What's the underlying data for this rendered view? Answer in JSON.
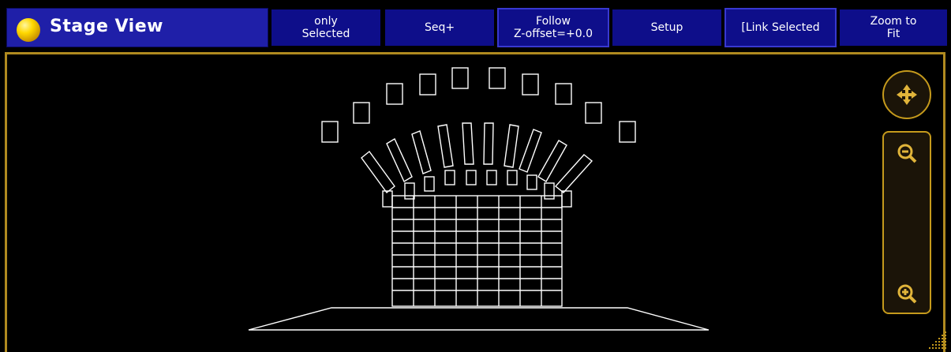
{
  "title": {
    "label": "Stage View"
  },
  "toolbar": {
    "only_selected": "only\nSelected",
    "seq_plus": "Seq+",
    "follow": "Follow\nZ-offset=+0.0",
    "setup": "Setup",
    "link_selected": "[Link Selected",
    "zoom_to_fit": "Zoom to\nFit"
  },
  "colors": {
    "title_bg": "#1f1fa8",
    "button_bg": "#0e0e8a",
    "accent": "#c59a1c",
    "wireframe": "#ffffff"
  },
  "icons": {
    "move": "move-arrows-icon",
    "zoom_out": "zoom-out-icon",
    "zoom_in": "zoom-in-icon"
  }
}
